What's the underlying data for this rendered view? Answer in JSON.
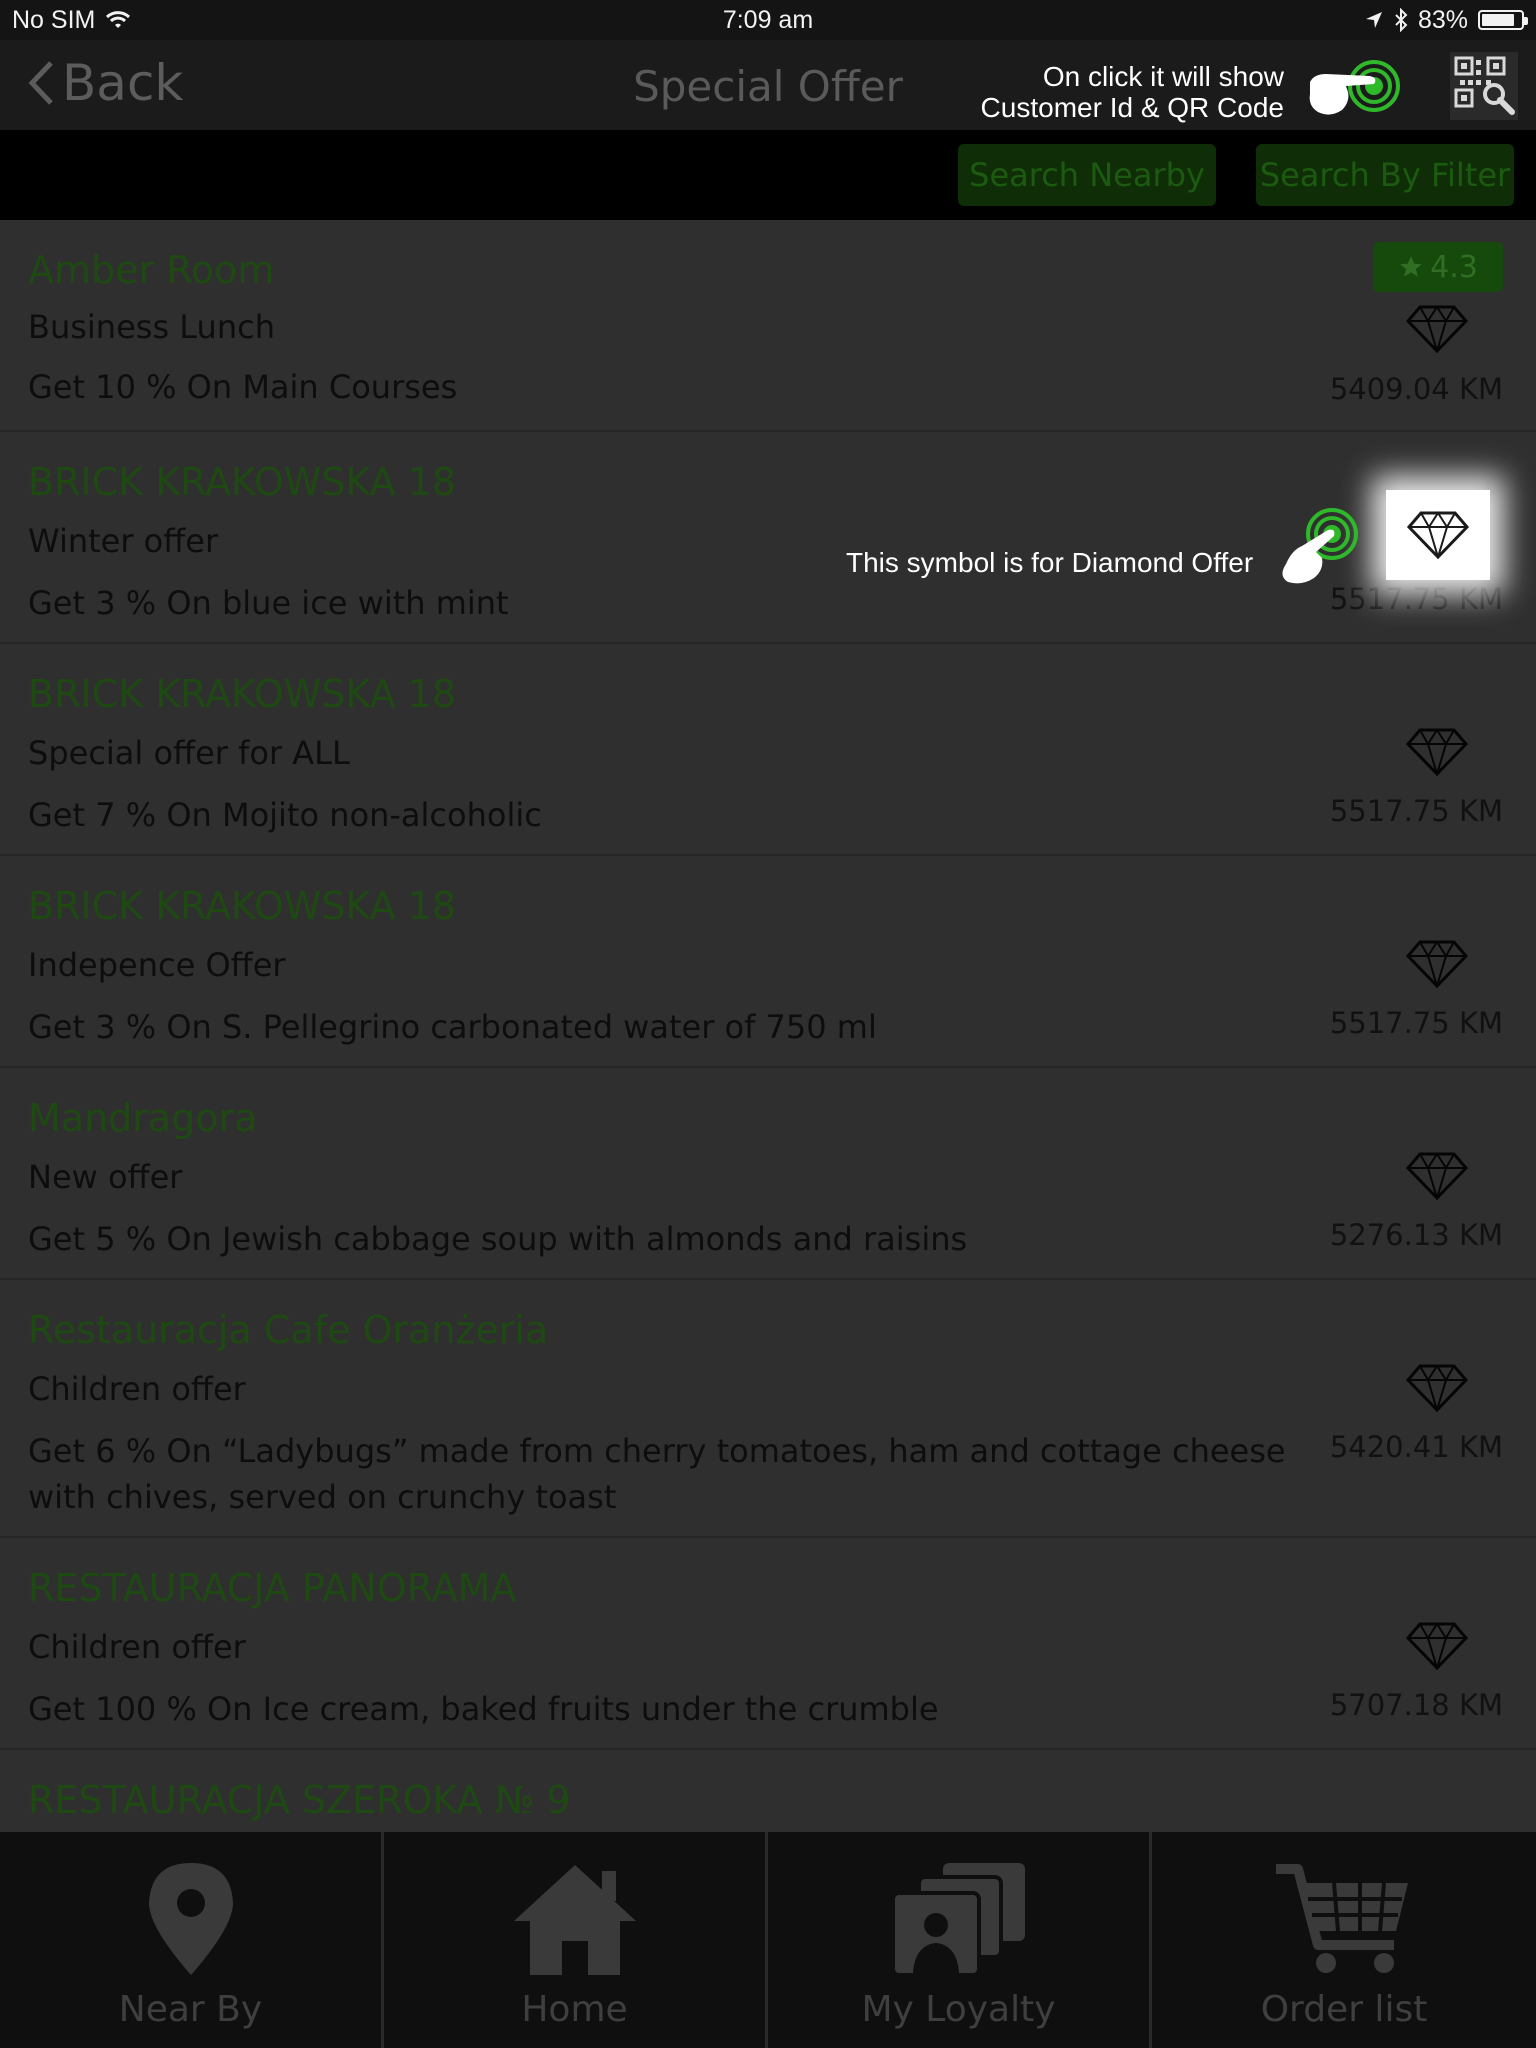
{
  "status_bar": {
    "carrier": "No SIM",
    "time": "7:09 am",
    "battery_percent": "83%",
    "battery_level": 0.83
  },
  "nav": {
    "back_label": "Back",
    "title": "Special Offer"
  },
  "filters": {
    "nearby_label": "Search Nearby",
    "filter_label": "Search By Filter"
  },
  "offers": [
    {
      "name": "Amber Room",
      "subtitle": "Business Lunch",
      "description": "Get 10 % On  Main Courses",
      "distance": "5409.04 KM",
      "rating": "4.3"
    },
    {
      "name": "BRICK KRAKOWSKA 18",
      "subtitle": "Winter offer",
      "description": "Get 3 % On  blue ice with mint",
      "distance": "5517.75 KM"
    },
    {
      "name": "BRICK KRAKOWSKA 18",
      "subtitle": "Special offer for ALL",
      "description": "Get 7 % On  Mojito non-alcoholic",
      "distance": "5517.75 KM"
    },
    {
      "name": "BRICK KRAKOWSKA 18",
      "subtitle": "Indepence Offer",
      "description": "Get 3 % On  S. Pellegrino carbonated water of 750 ml",
      "distance": "5517.75 KM"
    },
    {
      "name": "Mandragora",
      "subtitle": "New offer",
      "description": "Get 5 % On  Jewish cabbage soup with almonds and raisins",
      "distance": "5276.13 KM"
    },
    {
      "name": "Restauracja Cafe Oranżeria",
      "subtitle": "Children offer",
      "description": "Get 6 % On    “Ladybugs” made from cherry tomatoes, ham and cottage cheese with chives, served on crunchy toast",
      "distance": "5420.41 KM"
    },
    {
      "name": "RESTAURACJA PANORAMA",
      "subtitle": "Children offer",
      "description": "Get 100 % On  Ice cream, baked fruits under the crumble",
      "distance": "5707.18 KM"
    },
    {
      "name": "RESTAURACJA SZEROKA № 9"
    }
  ],
  "annotations": {
    "qr_line1": "On click it will show",
    "qr_line2": "Customer Id & QR Code",
    "diamond": "This symbol is for Diamond Offer"
  },
  "tabs": [
    {
      "label": "Near By",
      "icon": "map-pin-icon"
    },
    {
      "label": "Home",
      "icon": "home-icon"
    },
    {
      "label": "My Loyalty",
      "icon": "loyalty-cards-icon"
    },
    {
      "label": "Order list",
      "icon": "shopping-cart-icon"
    }
  ],
  "colors": {
    "accent_green": "#1e4912",
    "overlay": "#2f2f2f",
    "rating_bg": "#164a0c",
    "tab_bar": "#0f0f0f"
  }
}
